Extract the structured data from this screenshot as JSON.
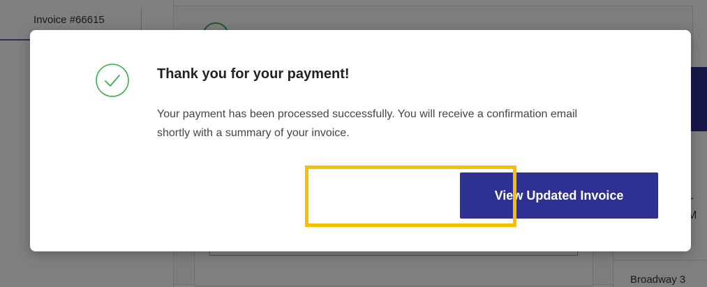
{
  "background": {
    "invoice_tab_label": "Invoice #66615",
    "right_panel_text1": "L",
    "right_panel_text2": "M",
    "right_panel_address": "Broadway 3"
  },
  "modal": {
    "title": "Thank you for your payment!",
    "message": "Your payment has been processed successfully. You will receive a confirmation email shortly with a summary of your invoice.",
    "primary_button_label": "View Updated Invoice"
  },
  "colors": {
    "brand": "#2f3192",
    "success": "#38b14a",
    "highlight": "#f8bf00"
  },
  "icons": {
    "status": "check-circle-icon"
  }
}
